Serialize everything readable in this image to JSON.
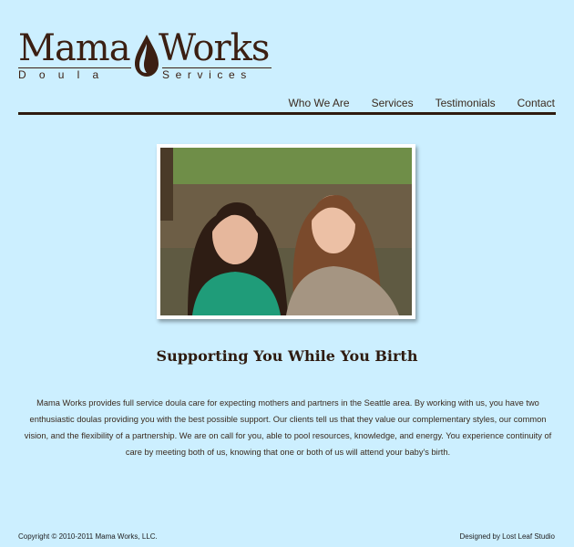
{
  "logo": {
    "word1": "Mama",
    "word2": "Works",
    "sub1": "Doula",
    "sub2": "Services"
  },
  "nav": {
    "items": [
      {
        "label": "Who We Are"
      },
      {
        "label": "Services"
      },
      {
        "label": "Testimonials"
      },
      {
        "label": "Contact"
      }
    ]
  },
  "main": {
    "headline": "Supporting You While You Birth",
    "body": "Mama Works provides full service doula care for expecting mothers and partners in the Seattle area.  By working with us, you have two enthusiastic doulas providing you with the best possible support.  Our clients tell us that they value our complementary styles, our common vision, and the flexibility of a partnership.  We are on call for you, able to pool resources, knowledge, and energy.   You experience continuity of care by meeting both of us, knowing that one or both of us will attend your baby's birth."
  },
  "footer": {
    "copyright": "Copyright © 2010-2011 Mama Works, LLC.",
    "credit": "Designed by Lost Leaf Studio"
  },
  "colors": {
    "background": "#ccefff",
    "brand_brown": "#3b1f12"
  }
}
